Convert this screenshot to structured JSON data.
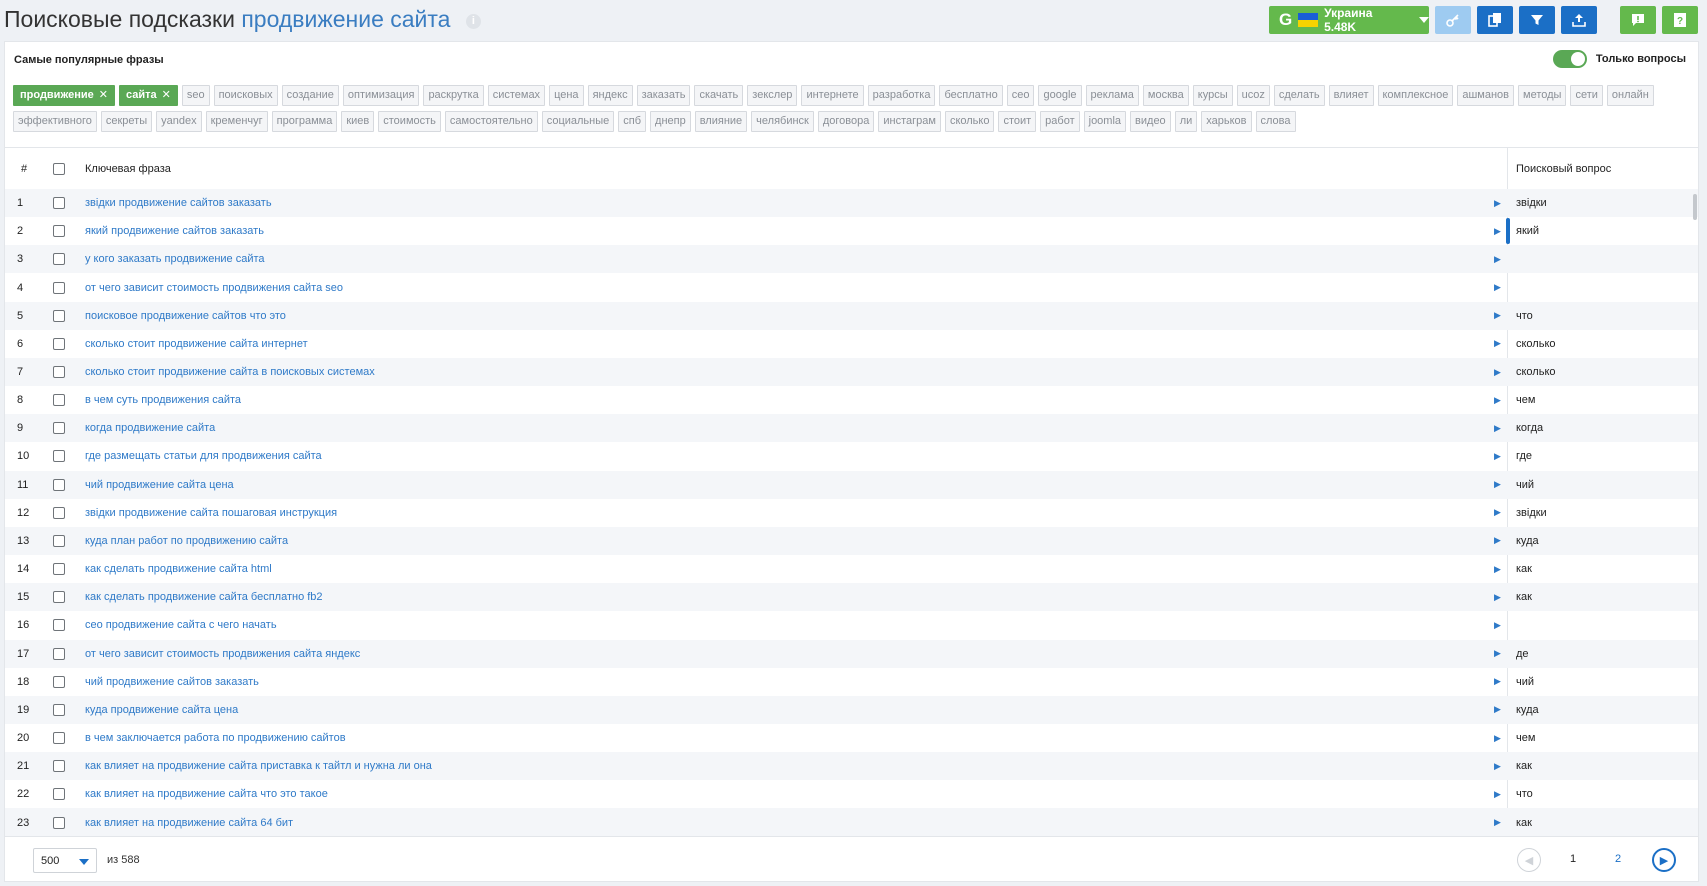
{
  "header": {
    "title_prefix": "Поисковые подсказки",
    "title_keyword": "продвижение сайта",
    "info_icon": "i",
    "google_label": "G",
    "region_label": "Украина 5.48K"
  },
  "colors": {
    "green": "#64b94c",
    "blue": "#1b6fc6",
    "link": "#2f7ac8"
  },
  "filters": {
    "title": "Самые популярные фразы",
    "only_questions_label": "Только вопросы",
    "only_questions_on": true,
    "active_chips": [
      "продвижение",
      "сайта"
    ],
    "chip_remove": "✕",
    "chips": [
      "seo",
      "поисковых",
      "создание",
      "оптимизация",
      "раскрутка",
      "системах",
      "цена",
      "яндекс",
      "заказать",
      "скачать",
      "зекслер",
      "интернете",
      "разработка",
      "бесплатно",
      "сео",
      "google",
      "реклама",
      "москва",
      "курсы",
      "ucoz",
      "сделать",
      "влияет",
      "комплексное",
      "ашманов",
      "методы",
      "сети",
      "онлайн",
      "эффективного",
      "секреты",
      "yandex",
      "кременчуг",
      "программа",
      "киев",
      "стоимость",
      "самостоятельно",
      "социальные",
      "спб",
      "днепр",
      "влияние",
      "челябинск",
      "договора",
      "инстаграм",
      "сколько",
      "стоит",
      "работ",
      "joomla",
      "видео",
      "ли",
      "харьков",
      "слова"
    ]
  },
  "table": {
    "col_num": "#",
    "col_phrase": "Ключевая фраза",
    "col_question": "Поисковый вопрос",
    "rows": [
      {
        "n": "1",
        "phrase": "звідки продвижение сайтов заказать",
        "q": "звідки"
      },
      {
        "n": "2",
        "phrase": "який продвижение сайтов заказать",
        "q": "який"
      },
      {
        "n": "3",
        "phrase": "у кого заказать продвижение сайта",
        "q": ""
      },
      {
        "n": "4",
        "phrase": "от чего зависит стоимость продвижения сайта seo",
        "q": ""
      },
      {
        "n": "5",
        "phrase": "поисковое продвижение сайтов что это",
        "q": "что"
      },
      {
        "n": "6",
        "phrase": "сколько стоит продвижение сайта интернет",
        "q": "сколько"
      },
      {
        "n": "7",
        "phrase": "сколько стоит продвижение сайта в поисковых системах",
        "q": "сколько"
      },
      {
        "n": "8",
        "phrase": "в чем суть продвижения сайта",
        "q": "чем"
      },
      {
        "n": "9",
        "phrase": "когда продвижение сайта",
        "q": "когда"
      },
      {
        "n": "10",
        "phrase": "где размещать статьи для продвижения сайта",
        "q": "где"
      },
      {
        "n": "11",
        "phrase": "чий продвижение сайта цена",
        "q": "чий"
      },
      {
        "n": "12",
        "phrase": "звідки продвижение сайта пошаговая инструкция",
        "q": "звідки"
      },
      {
        "n": "13",
        "phrase": "куда план работ по продвижению сайта",
        "q": "куда"
      },
      {
        "n": "14",
        "phrase": "как сделать продвижение сайта html",
        "q": "как"
      },
      {
        "n": "15",
        "phrase": "как сделать продвижение сайта бесплатно fb2",
        "q": "как"
      },
      {
        "n": "16",
        "phrase": "сео продвижение сайта с чего начать",
        "q": ""
      },
      {
        "n": "17",
        "phrase": "от чего зависит стоимость продвижения сайта яндекс",
        "q": "де"
      },
      {
        "n": "18",
        "phrase": "чий продвижение сайтов заказать",
        "q": "чий"
      },
      {
        "n": "19",
        "phrase": "куда продвижение сайта цена",
        "q": "куда"
      },
      {
        "n": "20",
        "phrase": "в чем заключается работа по продвижению сайтов",
        "q": "чем"
      },
      {
        "n": "21",
        "phrase": "как влияет на продвижение сайта приставка к тайтл и нужна ли она",
        "q": "как"
      },
      {
        "n": "22",
        "phrase": "как влияет на продвижение сайта что это такое",
        "q": "что"
      },
      {
        "n": "23",
        "phrase": "как влияет на продвижение сайта 64 бит",
        "q": "как"
      }
    ]
  },
  "pagination": {
    "page_size": "500",
    "total_label": "из 588",
    "pages": [
      "1",
      "2"
    ]
  }
}
